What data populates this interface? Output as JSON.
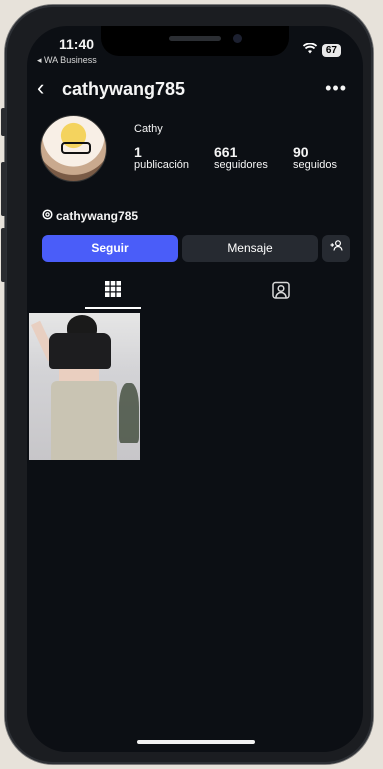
{
  "status": {
    "time": "11:40",
    "back_app": "◂ WA Business",
    "battery": "67"
  },
  "header": {
    "username": "cathywang785"
  },
  "profile": {
    "name": "Cathy",
    "stats": [
      {
        "num": "1",
        "label": "publicación"
      },
      {
        "num": "661",
        "label": "seguidores"
      },
      {
        "num": "90",
        "label": "seguidos"
      }
    ],
    "threads_handle": "cathywang785"
  },
  "actions": {
    "follow": "Seguir",
    "message": "Mensaje"
  },
  "colors": {
    "accent": "#4a5df9",
    "background": "#0c0f14",
    "secondary_button": "#262a31"
  }
}
